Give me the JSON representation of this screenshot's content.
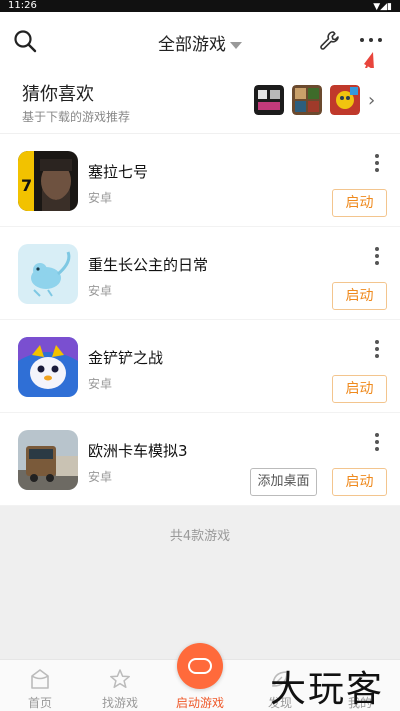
{
  "status_bar": {
    "time": "11:26",
    "signal": "▼◢▮"
  },
  "header": {
    "title": "全部游戏",
    "search_icon": "search-icon",
    "tool_icon": "wrench-icon",
    "more_icon": "more-dots-icon"
  },
  "recommend": {
    "title": "猜你喜欢",
    "subtitle": "基于下载的游戏推荐",
    "thumb_colors": [
      "#1c1c1c",
      "#6b4a2e",
      "#c0392b"
    ],
    "chevron": "›"
  },
  "games": [
    {
      "name": "塞拉七号",
      "platform": "安卓",
      "start_label": "启动"
    },
    {
      "name": "重生长公主的日常",
      "platform": "安卓",
      "start_label": "启动"
    },
    {
      "name": "金铲铲之战",
      "platform": "安卓",
      "start_label": "启动"
    },
    {
      "name": "欧洲卡车模拟3",
      "platform": "安卓",
      "start_label": "启动",
      "desk_label": "添加桌面"
    }
  ],
  "game_count": "共4款游戏",
  "tabs": [
    {
      "label": "首页",
      "icon": "home-icon"
    },
    {
      "label": "找游戏",
      "icon": "star-icon"
    },
    {
      "label": "启动游戏",
      "icon": "gamepad-icon"
    },
    {
      "label": "发现",
      "icon": "discover-icon"
    },
    {
      "label": "我的",
      "icon": "profile-icon"
    }
  ],
  "watermark": "大玩客",
  "colors": {
    "accent": "#ef8a1e",
    "tab_active": "#ef5a2b",
    "center_button": "#ff6a3b",
    "annotation_arrow": "#e8453c"
  }
}
